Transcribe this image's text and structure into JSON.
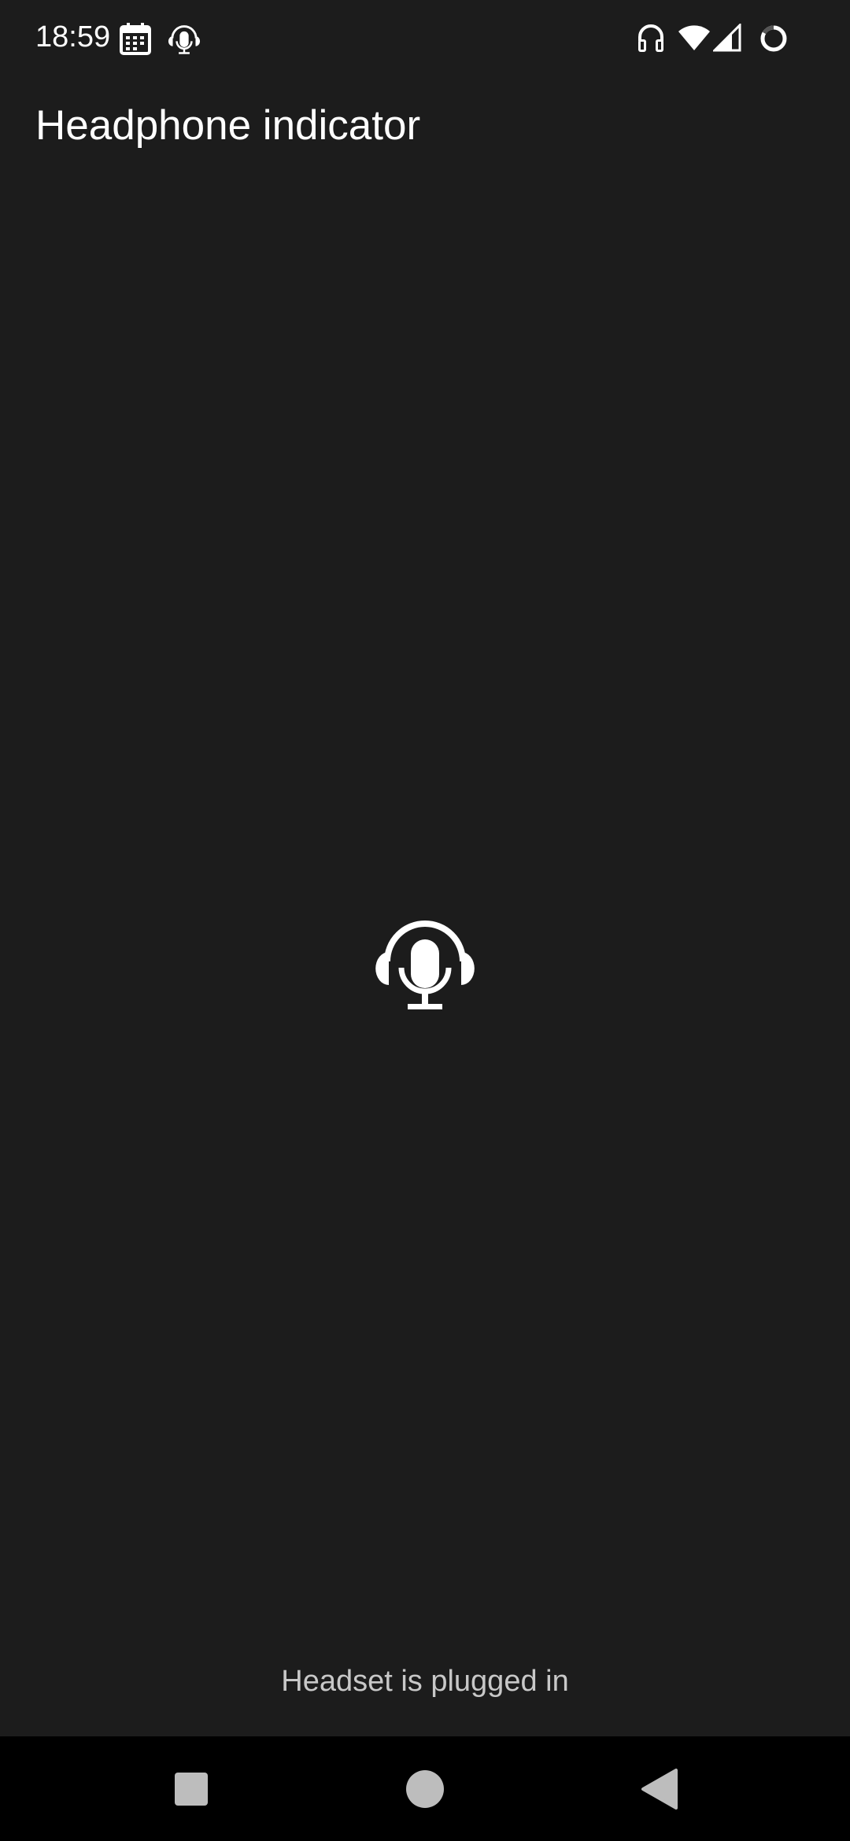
{
  "status_bar": {
    "time": "18:59",
    "left_icons": [
      "calendar-icon",
      "headset-mic-icon"
    ],
    "right_icons": [
      "headphones-icon",
      "wifi-icon",
      "cellular-signal-icon",
      "battery-ring-icon"
    ]
  },
  "app_bar": {
    "title": "Headphone indicator"
  },
  "main": {
    "indicator_icon": "headset-mic-icon",
    "status_message": "Headset is plugged in"
  },
  "nav_bar": {
    "buttons": [
      "recents-square-icon",
      "home-circle-icon",
      "back-triangle-icon"
    ]
  },
  "colors": {
    "background": "#1c1c1c",
    "text_primary": "#ffffff",
    "text_secondary": "#c8c8c8",
    "nav_background": "#000000",
    "nav_icon": "#bdbdbd"
  }
}
